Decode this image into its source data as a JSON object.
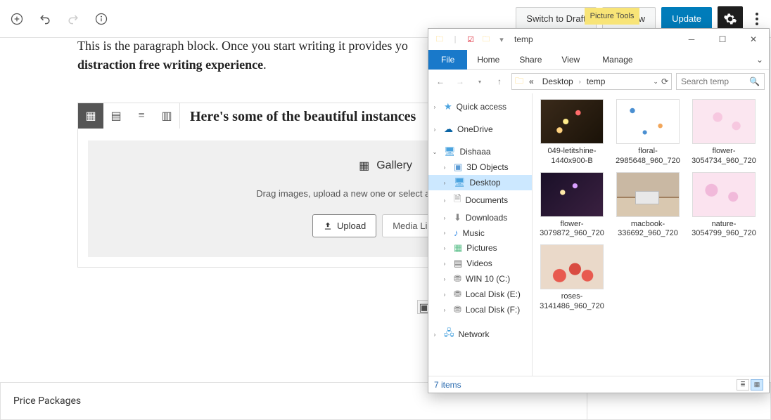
{
  "wp": {
    "topbar": {
      "switch_draft": "Switch to Draft",
      "preview": "Preview",
      "update": "Update"
    },
    "paragraph_pre": "This is the paragraph block. Once you start writing it provides yo",
    "paragraph_strong": "distraction free writing experience",
    "paragraph_post": ".",
    "block_heading": "Here's some of the beautiful instances",
    "gallery": {
      "title": "Gallery",
      "desc": "Drag images, upload a new one or select a file from your library.",
      "upload": "Upload",
      "media_library": "Media Library"
    },
    "bottom_section": "Price Packages"
  },
  "explorer": {
    "title": "temp",
    "quick_icons": [
      "folder",
      "divider",
      "check",
      "folder",
      "divider"
    ],
    "picture_tools": "Picture Tools",
    "tabs": {
      "file": "File",
      "home": "Home",
      "share": "Share",
      "view": "View",
      "manage": "Manage"
    },
    "address": {
      "pre": "«",
      "crumbs": [
        "Desktop",
        "temp"
      ]
    },
    "search_placeholder": "Search temp",
    "tree": [
      {
        "label": "Quick access",
        "icon": "i-star",
        "glyph": "★",
        "exp": "›"
      },
      {
        "spacer": true
      },
      {
        "label": "OneDrive",
        "icon": "i-cloud",
        "glyph": "☁",
        "exp": "›"
      },
      {
        "spacer": true
      },
      {
        "label": "Dishaaa",
        "icon": "i-monitor",
        "glyph": "🖥",
        "exp": "⌄"
      },
      {
        "label": "3D Objects",
        "icon": "i-3d",
        "glyph": "▣",
        "exp": "›",
        "lv2": true
      },
      {
        "label": "Desktop",
        "icon": "i-desktop",
        "glyph": "🖥",
        "exp": "›",
        "lv2": true,
        "selected": true
      },
      {
        "label": "Documents",
        "icon": "i-doc",
        "glyph": "🗎",
        "exp": "›",
        "lv2": true
      },
      {
        "label": "Downloads",
        "icon": "i-down",
        "glyph": "⬇",
        "exp": "›",
        "lv2": true
      },
      {
        "label": "Music",
        "icon": "i-music",
        "glyph": "♪",
        "exp": "›",
        "lv2": true
      },
      {
        "label": "Pictures",
        "icon": "i-pic",
        "glyph": "▦",
        "exp": "›",
        "lv2": true
      },
      {
        "label": "Videos",
        "icon": "i-video",
        "glyph": "▤",
        "exp": "›",
        "lv2": true
      },
      {
        "label": "WIN 10 (C:)",
        "icon": "i-drive",
        "glyph": "⛃",
        "exp": "›",
        "lv2": true
      },
      {
        "label": "Local Disk (E:)",
        "icon": "i-drive",
        "glyph": "⛃",
        "exp": "›",
        "lv2": true
      },
      {
        "label": "Local Disk (F:)",
        "icon": "i-drive",
        "glyph": "⛃",
        "exp": "›",
        "lv2": true
      },
      {
        "spacer": true
      },
      {
        "label": "Network",
        "icon": "i-net",
        "glyph": "🖧",
        "exp": "›"
      }
    ],
    "files": [
      {
        "name": "049-letitshine-1440x900-B",
        "thumb": "th1"
      },
      {
        "name": "floral-2985648_960_720",
        "thumb": "th2"
      },
      {
        "name": "flower-3054734_960_720",
        "thumb": "th3"
      },
      {
        "name": "flower-3079872_960_720",
        "thumb": "th4"
      },
      {
        "name": "macbook-336692_960_720",
        "thumb": "th5"
      },
      {
        "name": "nature-3054799_960_720",
        "thumb": "th6"
      },
      {
        "name": "roses-3141486_960_720",
        "thumb": "th7"
      }
    ],
    "status": "7 items"
  }
}
